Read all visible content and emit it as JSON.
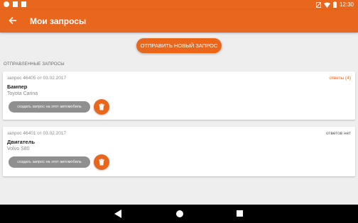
{
  "status_bar": {
    "time": "12:30",
    "icons": [
      "notification-dot-icon",
      "sim-icon",
      "cancel-sim-icon",
      "no-sim-icon",
      "wifi-icon",
      "battery-icon"
    ]
  },
  "toolbar": {
    "back_icon": "arrow-left-icon",
    "title": "Мои запросы"
  },
  "actions": {
    "send_new_label": "ОТПРАВИТЬ НОВЫЙ ЗАПРОС"
  },
  "section": {
    "label": "ОТПРАВЛЕННЫЕ ЗАПРОСЫ"
  },
  "requests": [
    {
      "meta": "запрос 46405 от 03.02.2017",
      "status": "ответы (4)",
      "status_color": "#e8671d",
      "part": "Бампер",
      "car": "Toyota Carina",
      "create_label": "создать запрос на этот автомобиль"
    },
    {
      "meta": "запрос 46401 от 03.02.2017",
      "status": "ответов нет",
      "status_color": "#555555",
      "part": "Двигатель",
      "car": "Volvo S80",
      "create_label": "создать запрос на этот автомобиль"
    }
  ],
  "colors": {
    "accent": "#e8671d",
    "secondary_button": "#8f8f8f",
    "background": "#eeeeee"
  }
}
